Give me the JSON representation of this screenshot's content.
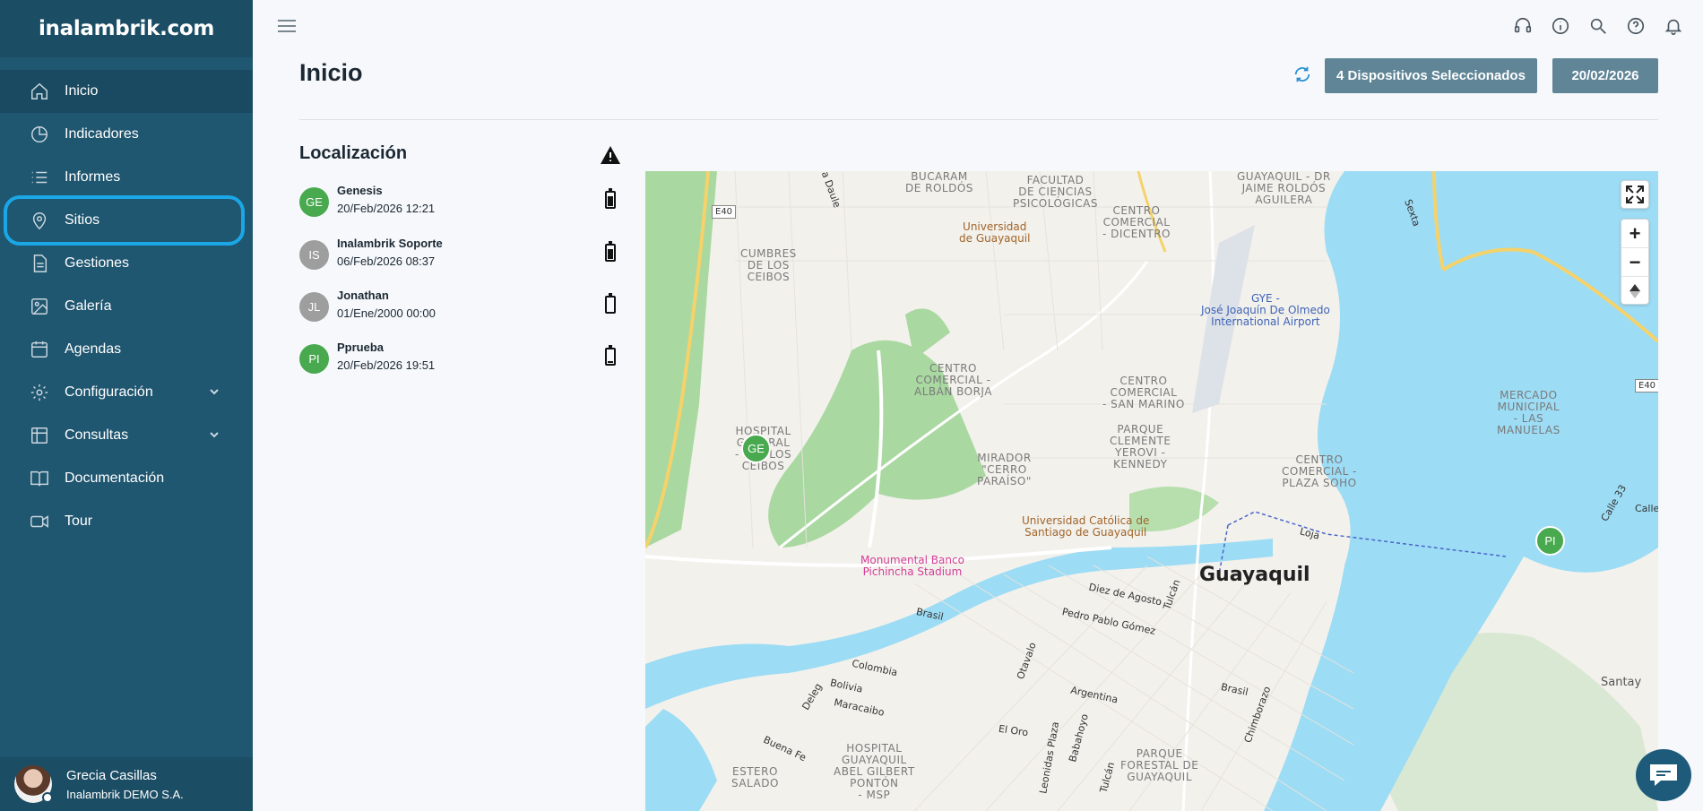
{
  "brand": {
    "name": "inalambrik.com"
  },
  "sidebar": {
    "items": [
      {
        "label": "Inicio",
        "icon": "home-icon"
      },
      {
        "label": "Indicadores",
        "icon": "pie-chart-icon"
      },
      {
        "label": "Informes",
        "icon": "list-icon"
      },
      {
        "label": "Sitios",
        "icon": "map-pin-icon"
      },
      {
        "label": "Gestiones",
        "icon": "document-icon"
      },
      {
        "label": "Galería",
        "icon": "image-icon"
      },
      {
        "label": "Agendas",
        "icon": "calendar-icon"
      },
      {
        "label": "Configuración",
        "icon": "gear-icon"
      },
      {
        "label": "Consultas",
        "icon": "table-icon"
      },
      {
        "label": "Documentación",
        "icon": "book-icon"
      },
      {
        "label": "Tour",
        "icon": "video-icon"
      }
    ]
  },
  "user": {
    "name": "Grecia Casillas",
    "org": "Inalambrik DEMO S.A."
  },
  "header": {
    "title": "Inicio",
    "devices_button": "4 Dispositivos Seleccionados",
    "date_button": "20/02/2026"
  },
  "location": {
    "title": "Localización",
    "devices": [
      {
        "initials": "GE",
        "name": "Genesis",
        "datetime": "20/Feb/2026 12:21",
        "color": "#48a94e",
        "battery": "high"
      },
      {
        "initials": "IS",
        "name": "Inalambrik Soporte",
        "datetime": "06/Feb/2026 08:37",
        "color": "#9e9e9e",
        "battery": "high"
      },
      {
        "initials": "JL",
        "name": "Jonathan",
        "datetime": "01/Ene/2000 00:00",
        "color": "#9e9e9e",
        "battery": "empty"
      },
      {
        "initials": "PI",
        "name": "Pprueba",
        "datetime": "20/Feb/2026 19:51",
        "color": "#48a94e",
        "battery": "low"
      }
    ]
  },
  "map": {
    "markers": [
      {
        "initials": "GE"
      },
      {
        "initials": "PI"
      }
    ],
    "labels": {
      "bucaram": "BUCARAM\nDE ROLDÓS",
      "facultad": "FACULTAD\nDE CIENCIAS\nPSICOLÓGICAS",
      "guayaquil_dr": "GUAYAQUIL - DR\nJAIME ROLDÓS\nAGUILERA",
      "sexta": "Sexta",
      "daule": "a Daule",
      "e40_1": "E40",
      "e40_2": "E40",
      "universidad": "Universidad\nde Guayaquil",
      "centro_dicentro": "CENTRO\nCOMERCIAL\n- DICENTRO",
      "cumbres": "CUMBRES\nDE LOS\nCEIBOS",
      "gye": "GYE -\nJosé Joaquín De Olmedo\nInternational Airport",
      "alban": "CENTRO\nCOMERCIAL -\nALBÁN BORJA",
      "sanmarino": "CENTRO\nCOMERCIAL\n- SAN MARINO",
      "mercado": "MERCADO\nMUNICIPAL\n- LAS\nMANUELAS",
      "hospital_ceibos": "HOSPITAL\nGENERAL\n- LOS LOS\nCEIBOS",
      "mirador": "MIRADOR\n\"CERRO\nPARAÍSO\"",
      "parque_kennedy": "PARQUE\nCLEMENTE\nYEROVI -\nKENNEDY",
      "plaza_soho": "CENTRO\nCOMERCIAL -\nPLAZA SOHO",
      "ucsg": "Universidad Católica de\nSantiago de Guayaquil",
      "loja": "Loja",
      "calle33": "Calle 33",
      "calle": "Calle",
      "estadio": "Monumental Banco\nPichincha Stadium",
      "guayaquil": "Guayaquil",
      "diez_agosto": "Diez de Agosto",
      "tulcan": "Tulcán",
      "pedro_pablo": "Pedro Pablo Gómez",
      "brasil": "Brasil",
      "colombia": "Colombia",
      "otavalo": "Otavalo",
      "argentina": "Argentina",
      "bolivia": "Bolivia",
      "deleg": "Deleg",
      "maracaibo": "Maracaibo",
      "brasil2": "Brasil",
      "chimborazo": "Chimborazo",
      "santay": "Santay",
      "eloro": "El Oro",
      "buenafe": "Buena Fe",
      "hospital_abel": "HOSPITAL\nGUAYAQUIL\nABEL GILBERT\nPONTÓN\n- MSP",
      "estero": "ESTERO\nSALADO",
      "leonidas": "Leonidas Plaza",
      "babahoyo": "Babahoyo",
      "tulcan2": "Tulcán",
      "parque_forestal": "PARQUE\nFORESTAL DE\nGUAYAQUIL"
    }
  },
  "colors": {
    "sidebar": "#1f5670",
    "accent": "#1ba7e6",
    "button": "#5f8597",
    "marker": "#48a94e",
    "water": "#9ddcf5"
  }
}
